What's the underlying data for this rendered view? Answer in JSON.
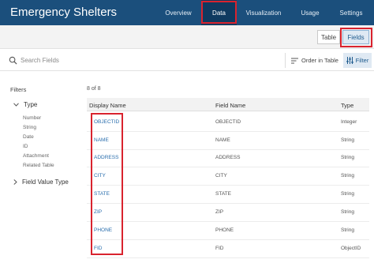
{
  "app": {
    "title": "Emergency Shelters"
  },
  "nav": {
    "overview": "Overview",
    "data": "Data",
    "visualization": "Visualization",
    "usage": "Usage",
    "settings": "Settings"
  },
  "view_toggle": {
    "table": "Table",
    "fields": "Fields"
  },
  "search": {
    "placeholder": "Search Fields"
  },
  "toolbar": {
    "order_label": "Order in Table",
    "filter_label": "Filter"
  },
  "filters": {
    "title": "Filters",
    "type_label": "Type",
    "type_options": [
      "Number",
      "String",
      "Date",
      "ID",
      "Attachment",
      "Related Table"
    ],
    "value_type_label": "Field Value Type"
  },
  "table": {
    "count": "8 of 8",
    "headers": {
      "display_name": "Display Name",
      "field_name": "Field Name",
      "type": "Type"
    },
    "rows": [
      {
        "display_name": "OBJECTID",
        "field_name": "OBJECTID",
        "type": "Integer"
      },
      {
        "display_name": "NAME",
        "field_name": "NAME",
        "type": "String"
      },
      {
        "display_name": "ADDRESS",
        "field_name": "ADDRESS",
        "type": "String"
      },
      {
        "display_name": "CITY",
        "field_name": "CITY",
        "type": "String"
      },
      {
        "display_name": "STATE",
        "field_name": "STATE",
        "type": "String"
      },
      {
        "display_name": "ZIP",
        "field_name": "ZIP",
        "type": "String"
      },
      {
        "display_name": "PHONE",
        "field_name": "PHONE",
        "type": "String"
      },
      {
        "display_name": "FID",
        "field_name": "FID",
        "type": "ObjectID"
      }
    ]
  },
  "colors": {
    "header_bg": "#1b4f7c",
    "highlight": "#d9232e",
    "link": "#2a6ead"
  }
}
